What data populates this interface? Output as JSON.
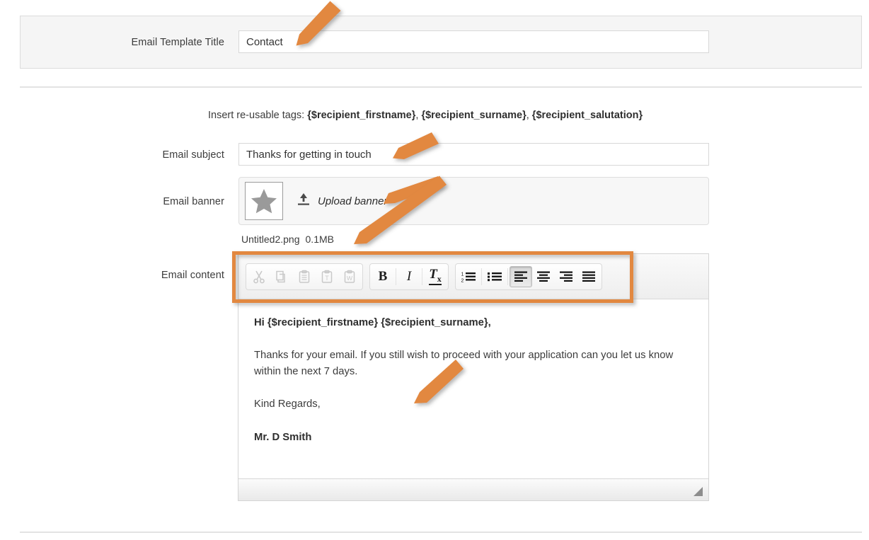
{
  "form": {
    "title_label": "Email Template Title",
    "title_value": "Contact",
    "title_placeholder": "",
    "tags_hint_prefix": "Insert re-usable tags: ",
    "tags": [
      "{$recipient_firstname}",
      "{$recipient_surname}",
      "{$recipient_salutation}"
    ],
    "tags_full": "Insert re-usable tags: {$recipient_firstname}, {$recipient_surname}, {$recipient_salutation}",
    "subject_label": "Email subject",
    "subject_value": "Thanks for getting in touch",
    "subject_placeholder": "",
    "banner_label": "Email banner",
    "upload_label": "Upload banner",
    "banner_filename": "Untitled2.png",
    "banner_filesize": "0.1MB",
    "content_label": "Email content"
  },
  "editor": {
    "toolbar": {
      "groups": [
        {
          "name": "clipboard",
          "buttons": [
            {
              "icon": "cut-icon",
              "label": "Cut",
              "disabled": true
            },
            {
              "icon": "copy-icon",
              "label": "Copy",
              "disabled": true
            },
            {
              "icon": "paste-icon",
              "label": "Paste",
              "disabled": true
            },
            {
              "icon": "paste-text-icon",
              "label": "Paste as plain text",
              "disabled": true
            },
            {
              "icon": "paste-word-icon",
              "label": "Paste from Word",
              "disabled": true
            }
          ]
        },
        {
          "name": "formatting",
          "buttons": [
            {
              "icon": "bold-icon",
              "label": "B",
              "disabled": false
            },
            {
              "icon": "italic-icon",
              "label": "I",
              "disabled": false
            },
            {
              "icon": "remove-format-icon",
              "label": "Tx",
              "disabled": false
            }
          ]
        },
        {
          "name": "paragraph",
          "buttons": [
            {
              "icon": "numbered-list-icon",
              "label": "Insert/Remove Numbered List",
              "disabled": false
            },
            {
              "icon": "bulleted-list-icon",
              "label": "Insert/Remove Bulleted List",
              "disabled": false
            },
            {
              "icon": "align-left-icon",
              "label": "Align Left",
              "disabled": false,
              "active": true
            },
            {
              "icon": "align-center-icon",
              "label": "Center",
              "disabled": false
            },
            {
              "icon": "align-right-icon",
              "label": "Align Right",
              "disabled": false
            },
            {
              "icon": "justify-icon",
              "label": "Justify",
              "disabled": false
            }
          ]
        }
      ]
    },
    "content": {
      "greeting": "Hi {$recipient_firstname} {$recipient_surname},",
      "body": "Thanks for your email.  If you still wish to proceed with your application can you let us know within the next 7 days.",
      "signoff": "Kind Regards,",
      "signature": "Mr. D Smith"
    }
  },
  "colors": {
    "annotation": "#E2883F",
    "highlight_box": "#E2883F",
    "panel_bg": "#F5F5F5",
    "panel_border": "#DCDCDC",
    "input_border": "#D8D8D8",
    "text": "#3C3C3C"
  },
  "annotations": {
    "highlight_target": "editor-toolbar",
    "arrows": [
      {
        "name": "arrow-to-template-title",
        "points_at": "title_value"
      },
      {
        "name": "arrow-to-subject",
        "points_at": "subject_value"
      },
      {
        "name": "arrow-to-upload-banner",
        "points_at": "upload_label"
      },
      {
        "name": "arrow-to-banner-file",
        "points_at": "banner_filename"
      },
      {
        "name": "arrow-to-content",
        "points_at": "editor_content"
      }
    ]
  }
}
